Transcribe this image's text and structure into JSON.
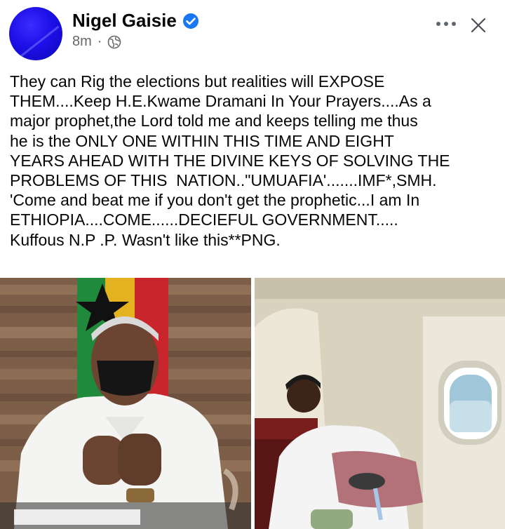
{
  "post": {
    "author": "Nigel Gaisie",
    "time": "8m",
    "separator": "·",
    "privacy_icon": "globe-icon",
    "verified_icon": "verified-badge-icon",
    "text_lines": [
      "They can Rig the elections but realities will EXPOSE",
      "THEM....Keep H.E.Kwame Dramani In Your Prayers....As a",
      "major prophet,the Lord told me and keeps telling me thus",
      "he is the ONLY ONE WITHIN THIS TIME AND EIGHT",
      "YEARS AHEAD WITH THE DIVINE KEYS OF SOLVING THE",
      "PROBLEMS OF THIS  NATION..\"UMUAFIA'.......IMF*,SMH.",
      "'Come and beat me if you don't get the prophetic...I am In",
      "ETHIOPIA....COME......DECIEFUL GOVERNMENT.....",
      "Kuffous N.P .P. Wasn't like this**PNG."
    ]
  },
  "colors": {
    "accent": "#1877f2",
    "muted": "#65676b",
    "text": "#050505",
    "avatar": "#1c10e8"
  },
  "photos": [
    {
      "subject": "man in white shirt and black face mask in front of Ghana flag"
    },
    {
      "subject": "man seated inside airplane cabin by window"
    }
  ]
}
